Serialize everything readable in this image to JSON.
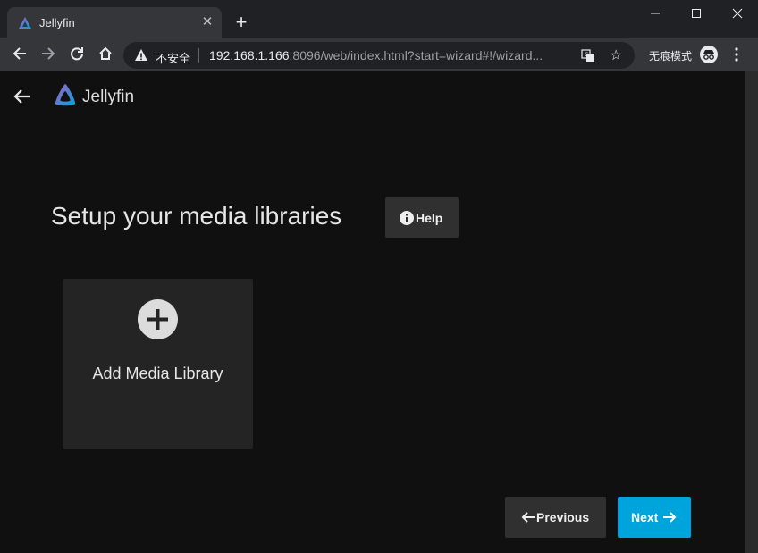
{
  "browser": {
    "tab_title": "Jellyfin",
    "new_tab": "+",
    "security_label": "不安全",
    "url_host": "192.168.1.166",
    "url_rest": ":8096/web/index.html?start=wizard#!/wizard...",
    "incognito_label": "无痕模式"
  },
  "app": {
    "brand": "Jellyfin",
    "page_title": "Setup your media libraries",
    "help_label": "Help",
    "add_library_label": "Add Media Library",
    "previous_label": "Previous",
    "next_label": "Next"
  },
  "colors": {
    "accent": "#00a4dc",
    "background": "#101010",
    "card": "#242424",
    "button": "#303030"
  }
}
